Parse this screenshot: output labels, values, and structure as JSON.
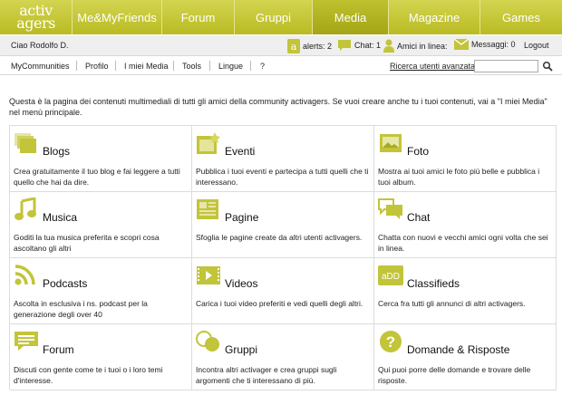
{
  "brand": {
    "line1": "activ",
    "line2": "agers",
    "color": "#c2c43a"
  },
  "nav": {
    "tabs": [
      {
        "label": "Me&MyFriends"
      },
      {
        "label": "Forum"
      },
      {
        "label": "Gruppi"
      },
      {
        "label": "Media",
        "active": true
      },
      {
        "label": "Magazine"
      },
      {
        "label": "Games"
      }
    ]
  },
  "userbar": {
    "greeting": "Ciao Rodolfo D.",
    "alerts": "alerts: 2",
    "chat": "Chat: 1",
    "friends_online": "Amici in linea:",
    "messages": "Messaggi: 0",
    "logout": "Logout"
  },
  "subnav": {
    "items": [
      {
        "label": "MyCommunities"
      },
      {
        "label": "Profilo"
      },
      {
        "label": "I miei Media"
      },
      {
        "label": "Tools"
      },
      {
        "label": "Lingue"
      },
      {
        "label": "?"
      }
    ],
    "advanced_search": "Ricerca utenti avanzata",
    "search_value": ""
  },
  "intro": "Questa è la pagina dei contenuti multimediali di tutti gli amici della community activagers. Se vuoi creare anche tu i tuoi contenuti, vai a \"I miei Media\" nel menù principale.",
  "cards": [
    {
      "title": "Blogs",
      "icon": "blogs-icon",
      "desc": "Crea gratuitamente il tuo blog e fai leggere a tutti quello che hai da dire."
    },
    {
      "title": "Eventi",
      "icon": "eventi-icon",
      "desc": "Pubblica i tuoi eventi e partecipa a tutti quelli che ti interessano."
    },
    {
      "title": "Foto",
      "icon": "foto-icon",
      "desc": "Mostra ai tuoi amici le foto più belle e pubblica i tuoi album."
    },
    {
      "title": "Musica",
      "icon": "musica-icon",
      "desc": "Goditi la tua musica preferita e scopri cosa ascoltano gli altri"
    },
    {
      "title": "Pagine",
      "icon": "pagine-icon",
      "desc": "Sfoglia le pagine create da altri utenti activagers."
    },
    {
      "title": "Chat",
      "icon": "chat-icon",
      "desc": "Chatta con nuovi e vecchi amici ogni volta che sei in linea."
    },
    {
      "title": "Podcasts",
      "icon": "podcasts-icon",
      "desc": "Ascolta in esclusiva i ns. podcast per la generazione degli over 40"
    },
    {
      "title": "Videos",
      "icon": "videos-icon",
      "desc": "Carica i tuoi video preferiti e vedi quelli degli altri."
    },
    {
      "title": "Classifieds",
      "icon": "classifieds-icon",
      "desc": "Cerca fra tutti gli annunci di altri activagers."
    },
    {
      "title": "Forum",
      "icon": "forum-icon",
      "desc": "Discuti con gente come te i tuoi o i loro temi d'interesse."
    },
    {
      "title": "Gruppi",
      "icon": "gruppi-icon",
      "desc": "Incontra altri activager e crea gruppi sugli argomenti che ti interessano di più."
    },
    {
      "title": "Domande & Risposte",
      "icon": "domande-icon",
      "desc": "Qui puoi porre delle domande e trovare delle risposte."
    }
  ],
  "classifieds_icon_text": "aDD",
  "domande_icon_text": "?"
}
